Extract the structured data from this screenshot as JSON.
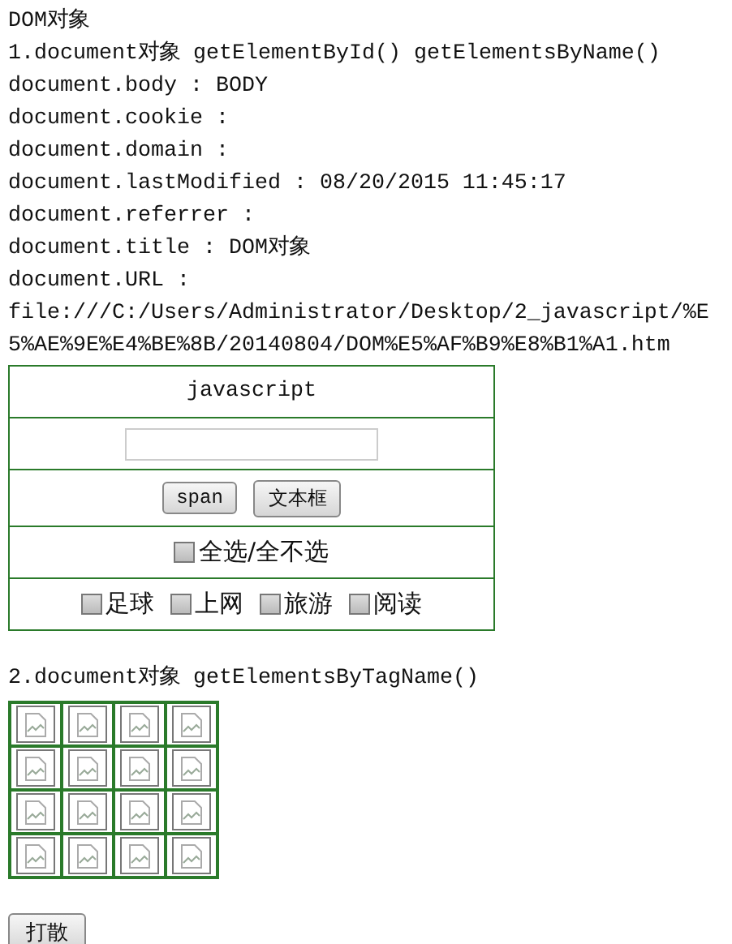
{
  "title": "DOM对象",
  "section_1": {
    "heading": "1.document对象 getElementById() getElementsByName()",
    "lines": [
      "document.body : BODY",
      "document.cookie :",
      "document.domain :",
      "document.lastModified : 08/20/2015 11:45:17",
      "document.referrer :",
      "document.title : DOM对象",
      "document.URL : file:///C:/Users/Administrator/Desktop/2_javascript/%E5%AE%9E%E4%BE%8B/20140804/DOM%E5%AF%B9%E8%B1%A1.htm"
    ],
    "table": {
      "header": "javascript",
      "buttons": [
        "span",
        "文本框"
      ],
      "select_all": {
        "label": "全选/全不选",
        "checked": false
      },
      "hobbies": [
        {
          "label": "足球",
          "checked": false
        },
        {
          "label": "上网",
          "checked": false
        },
        {
          "label": "旅游",
          "checked": false
        },
        {
          "label": "阅读",
          "checked": false
        }
      ]
    }
  },
  "section_2": {
    "heading": "2.document对象 getElementsByTagName()"
  },
  "scatter_button": "打散"
}
